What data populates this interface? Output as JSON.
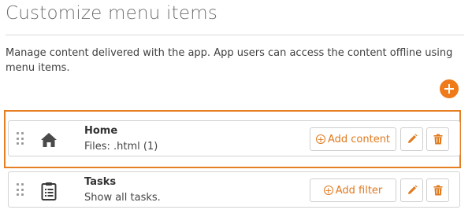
{
  "page": {
    "title": "Customize menu items",
    "description": "Manage content delivered with the app. App users can access the content offline using menu items."
  },
  "toolbar": {
    "add_icon": "plus-circle-icon"
  },
  "accent_color": "#ee7a1a",
  "menu_items": [
    {
      "name": "Home",
      "subtitle": "Files: .html (1)",
      "icon": "home-icon",
      "action_label": "Add content",
      "highlighted": true
    },
    {
      "name": "Tasks",
      "subtitle": "Show all tasks.",
      "icon": "clipboard-list-icon",
      "action_label": "Add filter",
      "highlighted": false
    }
  ]
}
